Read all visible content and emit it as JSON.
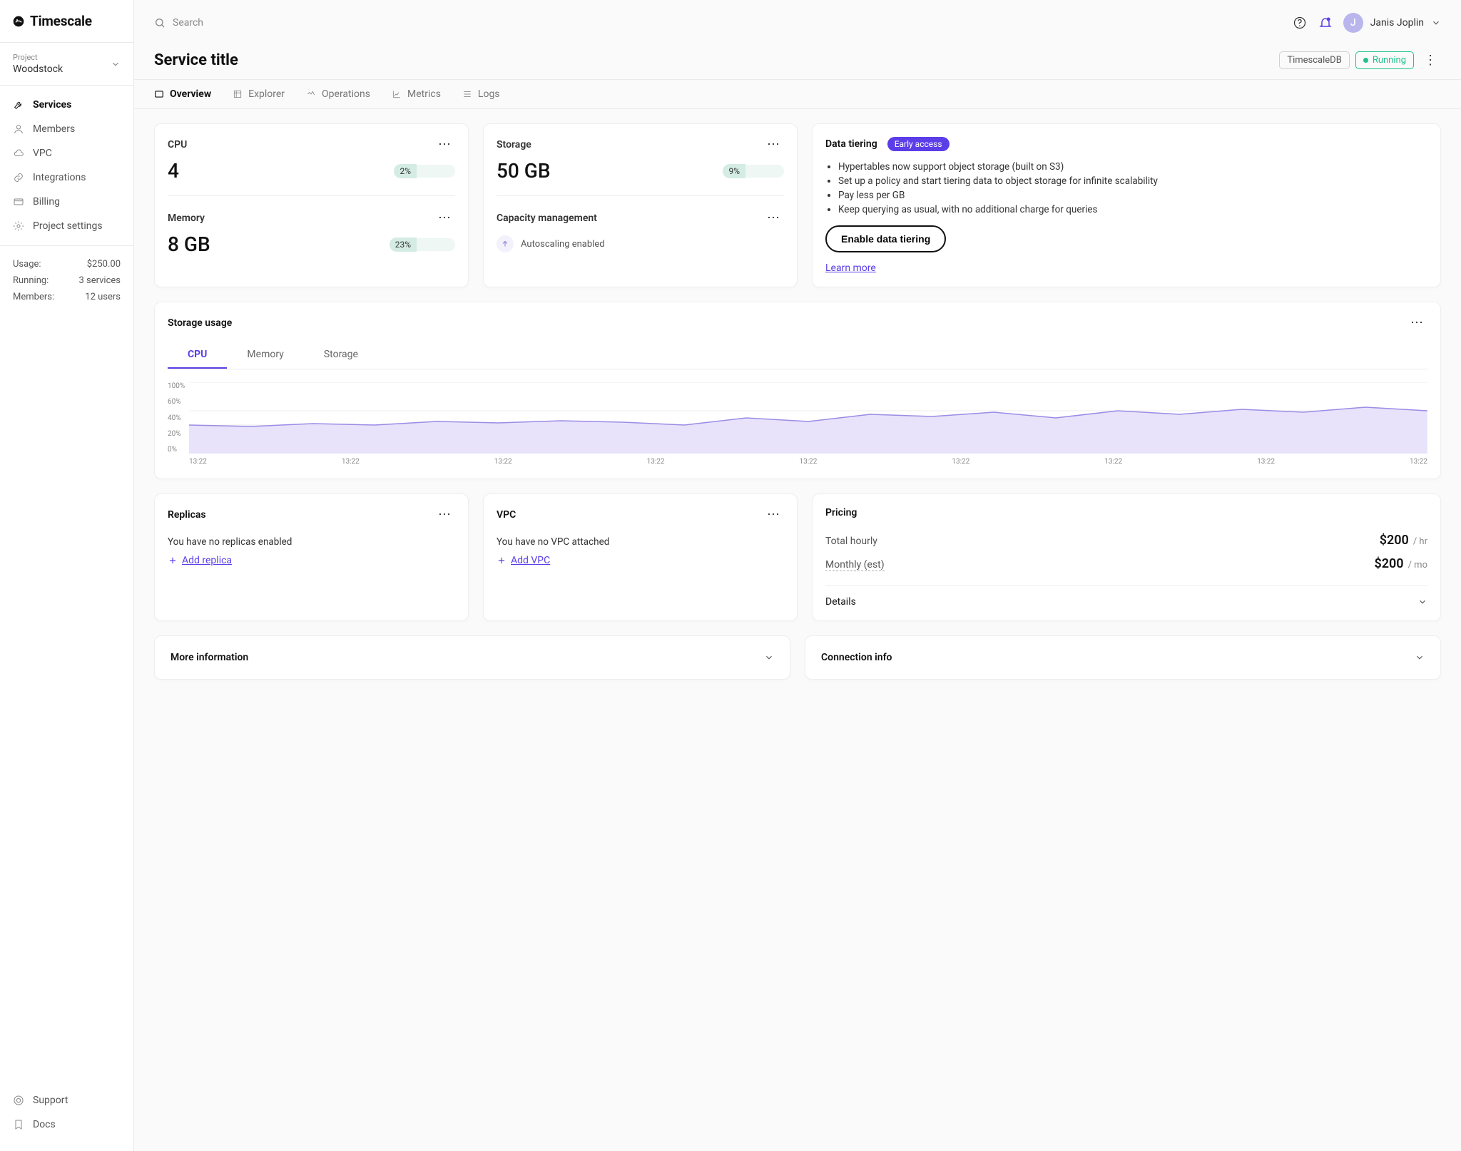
{
  "brand": "Timescale",
  "search_placeholder": "Search",
  "user": {
    "name": "Janis Joplin",
    "initial": "J"
  },
  "sidebar": {
    "project_label": "Project",
    "project_name": "Woodstock",
    "nav": [
      {
        "label": "Services",
        "icon": "wrench"
      },
      {
        "label": "Members",
        "icon": "person"
      },
      {
        "label": "VPC",
        "icon": "cloud"
      },
      {
        "label": "Integrations",
        "icon": "link"
      },
      {
        "label": "Billing",
        "icon": "card"
      },
      {
        "label": "Project settings",
        "icon": "gear"
      }
    ],
    "usage": {
      "usage_label": "Usage:",
      "usage_value": "$250.00",
      "running_label": "Running:",
      "running_value": "3 services",
      "members_label": "Members:",
      "members_value": "12 users"
    },
    "bottom": [
      {
        "label": "Support",
        "icon": "lifebuoy"
      },
      {
        "label": "Docs",
        "icon": "bookmark"
      }
    ]
  },
  "page": {
    "title": "Service title",
    "db_badge": "TimescaleDB",
    "status_badge": "Running"
  },
  "tabs": [
    "Overview",
    "Explorer",
    "Operations",
    "Metrics",
    "Logs"
  ],
  "metrics": {
    "cpu": {
      "title": "CPU",
      "value": "4",
      "pct": "2%"
    },
    "storage": {
      "title": "Storage",
      "value": "50 GB",
      "pct": "9%"
    },
    "memory": {
      "title": "Memory",
      "value": "8 GB",
      "pct": "23%"
    },
    "capacity": {
      "title": "Capacity management",
      "status": "Autoscaling enabled"
    }
  },
  "tiering": {
    "title": "Data tiering",
    "badge": "Early access",
    "bullets": [
      "Hypertables now support object storage (built on S3)",
      "Set up a policy and start tiering data to object storage for infinite scalability",
      "Pay less per GB",
      "Keep querying as usual, with no additional charge for queries"
    ],
    "cta": "Enable data tiering",
    "learn": "Learn more"
  },
  "storage_usage": {
    "title": "Storage usage",
    "tabs": [
      "CPU",
      "Memory",
      "Storage"
    ]
  },
  "chart_data": {
    "type": "area",
    "title": "Storage usage – CPU",
    "ylabel": "%",
    "ylim": [
      0,
      100
    ],
    "yticks": [
      "100%",
      "60%",
      "40%",
      "20%",
      "0%"
    ],
    "categories": [
      "13:22",
      "13:22",
      "13:22",
      "13:22",
      "13:22",
      "13:22",
      "13:22",
      "13:22",
      "13:22"
    ],
    "values": [
      40,
      38,
      42,
      40,
      45,
      43,
      46,
      44,
      40,
      50,
      45,
      55,
      52,
      58,
      50,
      60,
      55,
      62,
      58,
      65,
      60
    ]
  },
  "replicas": {
    "title": "Replicas",
    "text": "You have no replicas enabled",
    "add": "Add replica"
  },
  "vpc": {
    "title": "VPC",
    "text": "You have no VPC attached",
    "add": "Add VPC"
  },
  "pricing": {
    "title": "Pricing",
    "hourly_label": "Total hourly",
    "hourly_value": "$200",
    "hourly_unit": "/ hr",
    "monthly_label": "Monthly (est)",
    "monthly_value": "$200",
    "monthly_unit": "/ mo",
    "details": "Details"
  },
  "more_info": "More information",
  "conn_info": "Connection info"
}
